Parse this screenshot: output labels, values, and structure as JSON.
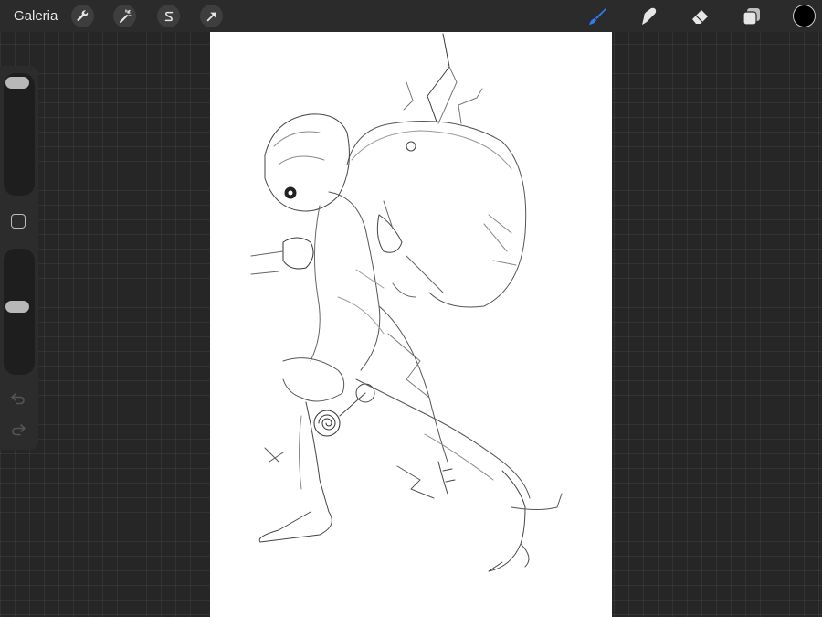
{
  "toolbar": {
    "gallery_label": "Galeria",
    "left_tools": [
      {
        "name": "actions",
        "icon": "wrench-icon"
      },
      {
        "name": "adjustments",
        "icon": "magic-wand-icon"
      },
      {
        "name": "selection",
        "icon": "selection-s-icon"
      },
      {
        "name": "transform",
        "icon": "arrow-cursor-icon"
      }
    ],
    "right_tools": [
      {
        "name": "brush",
        "icon": "brush-icon",
        "active": true
      },
      {
        "name": "smudge",
        "icon": "smudge-icon"
      },
      {
        "name": "eraser",
        "icon": "eraser-icon"
      },
      {
        "name": "layers",
        "icon": "layers-icon"
      }
    ],
    "active_color": "#000000",
    "accent_color": "#2f7df6"
  },
  "sidebar": {
    "brush_size_level": 1.0,
    "opacity_level": 0.55
  }
}
